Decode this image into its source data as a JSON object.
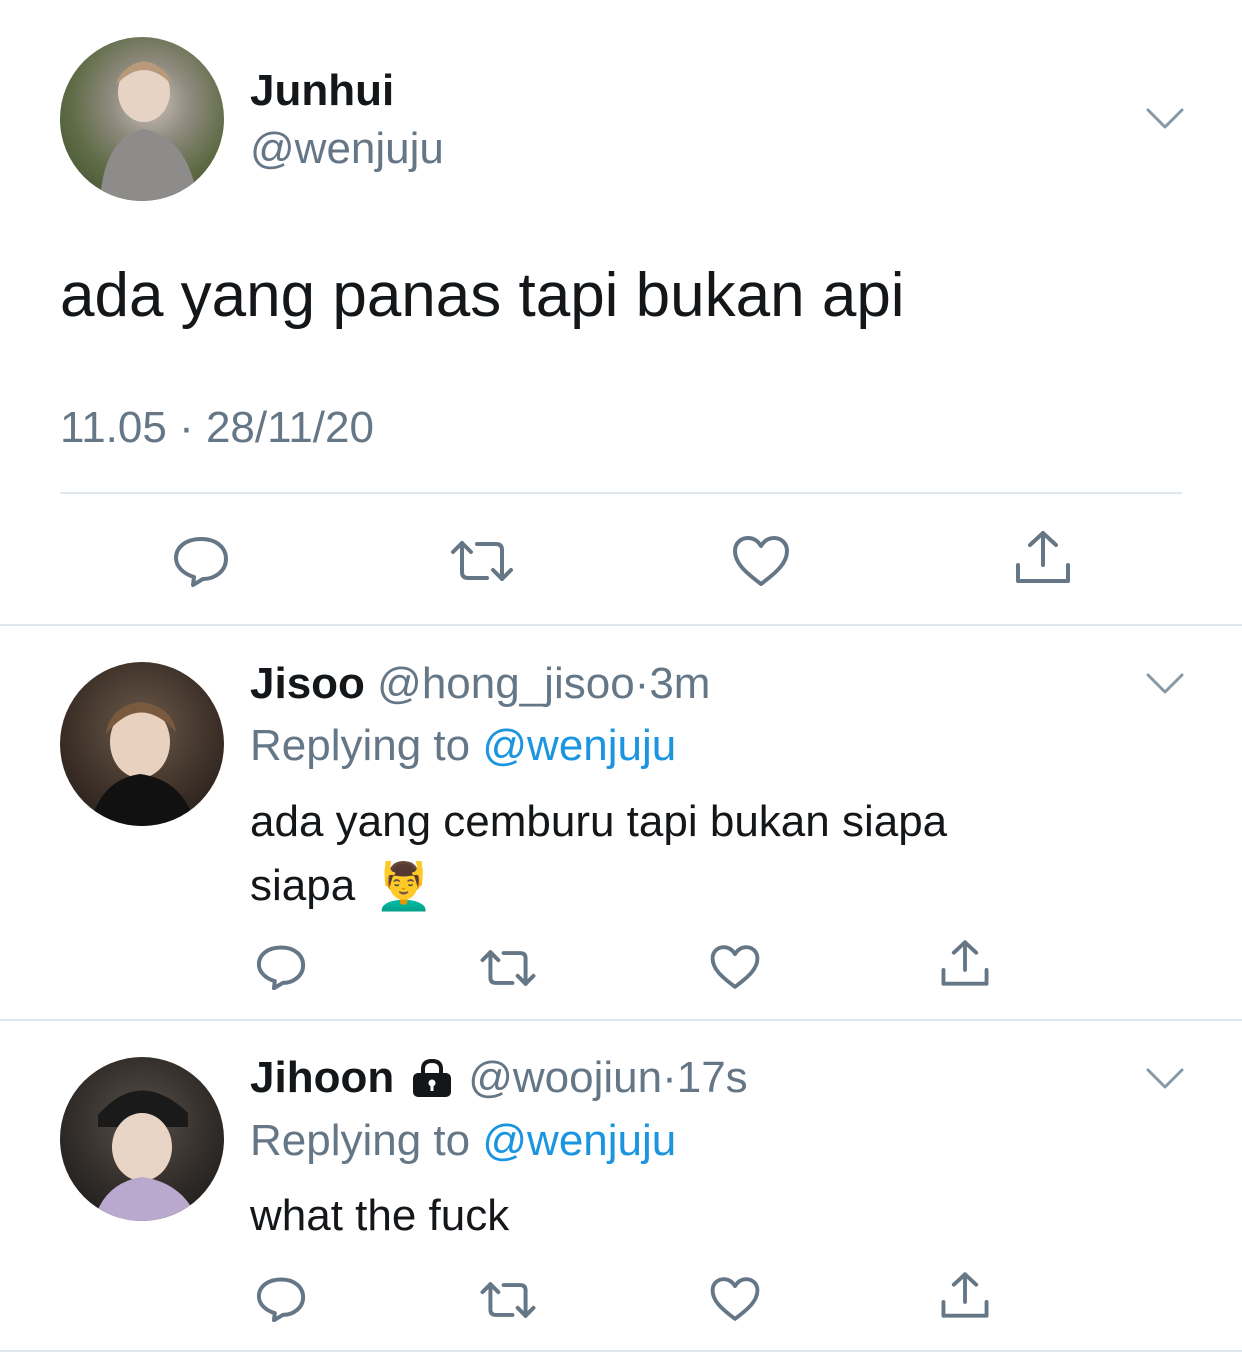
{
  "main_tweet": {
    "display_name": "Junhui",
    "handle": "@wenjuju",
    "text": "ada yang panas tapi bukan api",
    "timestamp": "11.05 · 28/11/20"
  },
  "replies": [
    {
      "display_name": "Jisoo",
      "handle": "@hong_jisoo",
      "separator": "·",
      "time": "3m",
      "replying_prefix": "Replying to",
      "replying_to": "@wenjuju",
      "text_line1": "ada yang cemburu tapi bukan siapa",
      "text_line2": "siapa",
      "emoji": "💆‍♂️"
    },
    {
      "display_name": "Jihoon",
      "handle": "@woojiun",
      "separator": "·",
      "time": "17s",
      "replying_prefix": "Replying to",
      "replying_to": "@wenjuju",
      "text_line1": "what the fuck",
      "locked": true
    }
  ],
  "icons": [
    "chevron-down-icon",
    "reply-icon",
    "retweet-icon",
    "like-icon",
    "share-icon",
    "lock-icon"
  ],
  "colors": {
    "accent": "#1b95e0",
    "secondary_text": "#657786",
    "divider": "#e1e8ed",
    "icon": "#657786"
  }
}
